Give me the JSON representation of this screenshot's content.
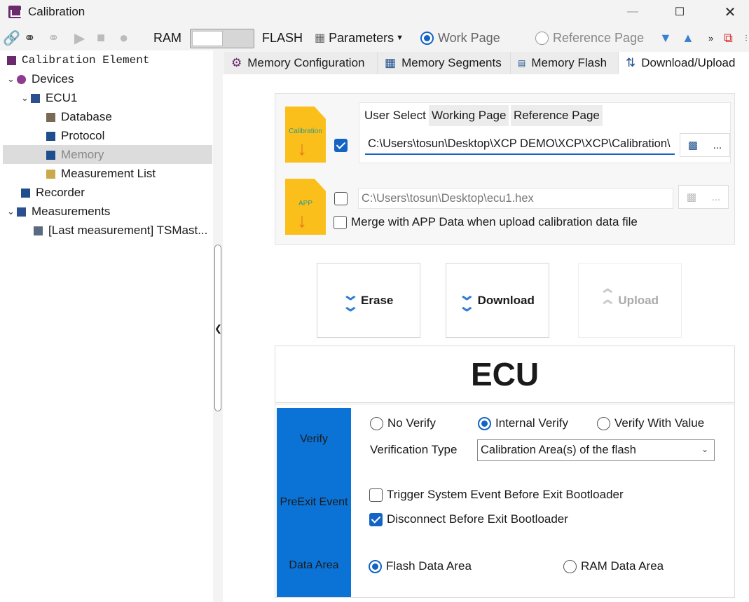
{
  "window": {
    "title": "Calibration"
  },
  "toolbar": {
    "ram_label": "RAM",
    "flash_label": "FLASH",
    "parameters_label": "Parameters",
    "work_page_label": "Work Page",
    "reference_page_label": "Reference Page"
  },
  "tree": {
    "root": "Calibration Element",
    "items": [
      {
        "label": "Devices"
      },
      {
        "label": "ECU1"
      },
      {
        "label": "Database"
      },
      {
        "label": "Protocol"
      },
      {
        "label": "Memory"
      },
      {
        "label": "Measurement List"
      },
      {
        "label": "Recorder"
      },
      {
        "label": "Measurements"
      },
      {
        "label": "[Last measurement] TSMast..."
      }
    ]
  },
  "tabs": [
    {
      "label": "Memory Configuration"
    },
    {
      "label": "Memory Segments"
    },
    {
      "label": "Memory Flash"
    },
    {
      "label": "Download/Upload"
    }
  ],
  "files": {
    "calibration_icon_label": "Calibration",
    "app_icon_label": "APP",
    "subtabs": [
      "User Select",
      "Working Page",
      "Reference Page"
    ],
    "calibration_path": "C:\\Users\\tosun\\Desktop\\XCP DEMO\\XCP\\XCP\\Calibration\\",
    "app_path": "C:\\Users\\tosun\\Desktop\\ecu1.hex",
    "browse_label": "...",
    "merge_label": "Merge with APP Data when upload calibration data file"
  },
  "actions": {
    "erase": "Erase",
    "download": "Download",
    "upload": "Upload"
  },
  "ecu_title": "ECU",
  "options": {
    "verify_label": "Verify",
    "no_verify": "No Verify",
    "internal_verify": "Internal Verify",
    "verify_with_value": "Verify With Value",
    "verification_type_label": "Verification Type",
    "verification_type_value": "Calibration Area(s) of the flash",
    "preexit_label": "PreExit Event",
    "trigger_system_event": "Trigger System Event Before Exit Bootloader",
    "disconnect_before_exit": "Disconnect Before Exit Bootloader",
    "data_area_label": "Data Area",
    "flash_data_area": "Flash Data Area",
    "ram_data_area": "RAM Data Area"
  },
  "colors": {
    "accent": "#1364c4",
    "option_band": "#0b73d6",
    "file_icon": "#fbbf1c"
  }
}
